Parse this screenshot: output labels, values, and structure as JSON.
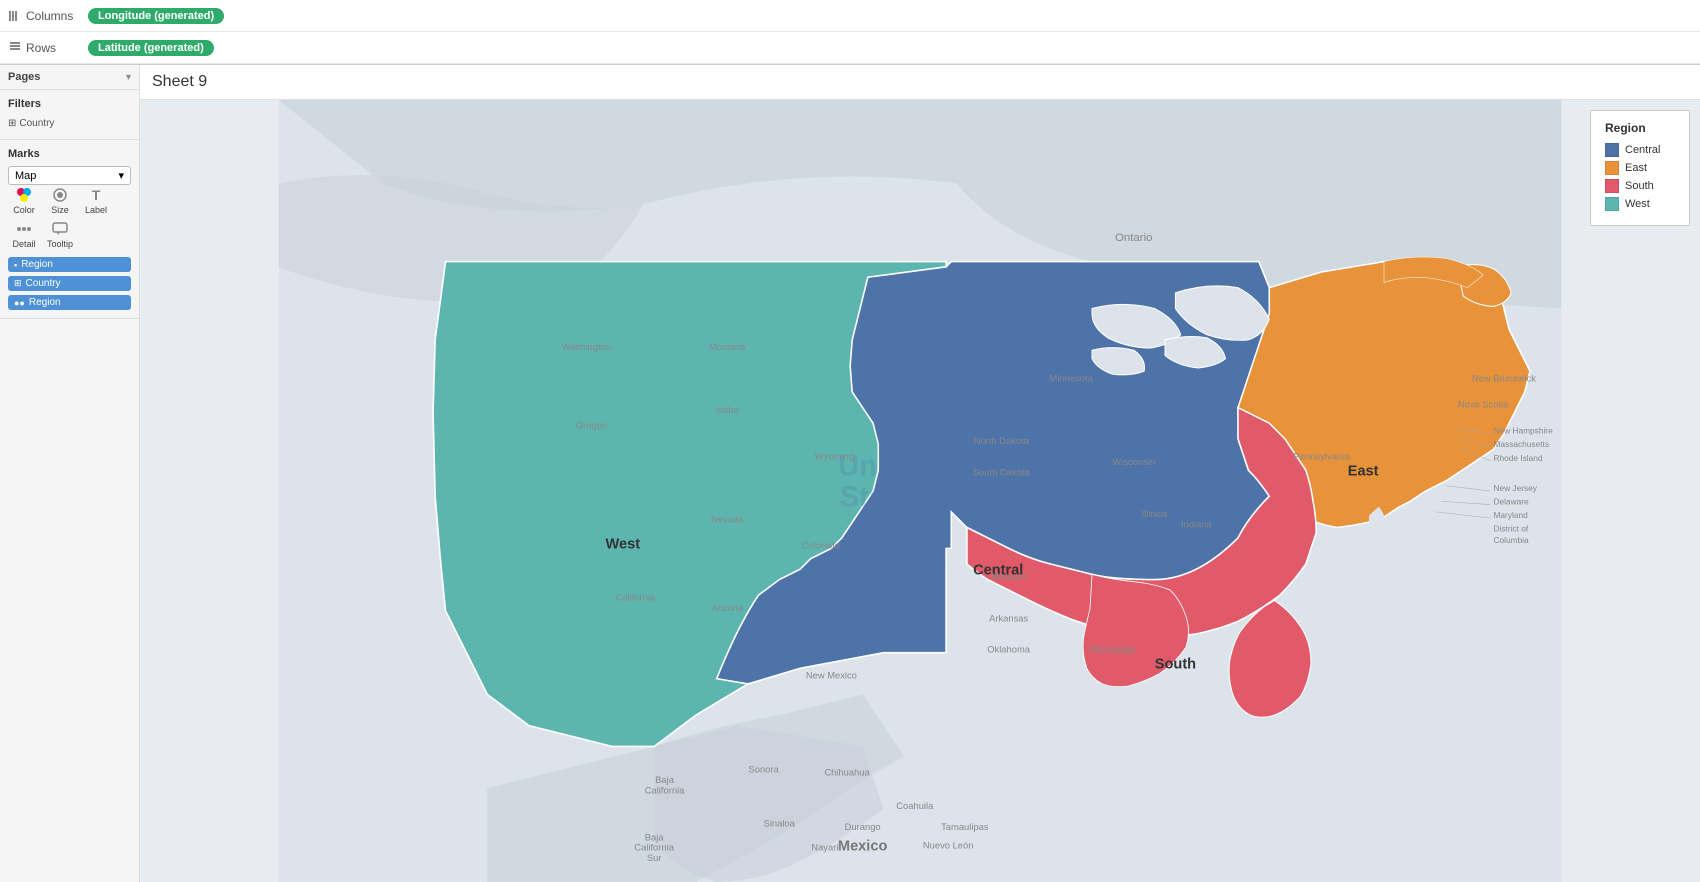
{
  "header": {
    "columns_label": "Columns",
    "columns_pill": "Longitude (generated)",
    "rows_label": "Rows",
    "rows_pill": "Latitude (generated)"
  },
  "left_panel": {
    "pages_label": "Pages",
    "filters_label": "Filters",
    "marks_label": "Marks",
    "marks_type": "Map",
    "marks_icons": [
      {
        "name": "color",
        "label": "Color",
        "icon": "⬛"
      },
      {
        "name": "size",
        "label": "Size",
        "icon": "◉"
      },
      {
        "name": "label",
        "label": "Label",
        "icon": "T"
      },
      {
        "name": "detail",
        "label": "Detail",
        "icon": "⋯"
      },
      {
        "name": "tooltip",
        "label": "Tooltip",
        "icon": "💬"
      }
    ],
    "mark_pills": [
      {
        "icon": "▪",
        "label": "Region"
      },
      {
        "icon": "⊞",
        "label": "Country"
      },
      {
        "icon": "●●●",
        "label": "Region"
      }
    ]
  },
  "sheet": {
    "title": "Sheet 9"
  },
  "legend": {
    "title": "Region",
    "items": [
      {
        "label": "Central",
        "color": "#4e73a8"
      },
      {
        "label": "East",
        "color": "#e8923a"
      },
      {
        "label": "South",
        "color": "#e05a6a"
      },
      {
        "label": "West",
        "color": "#5db5b0"
      }
    ]
  },
  "map": {
    "region_labels": [
      {
        "id": "west",
        "label": "West",
        "x": "36%",
        "y": "56%"
      },
      {
        "id": "central",
        "label": "Central",
        "x": "54%",
        "y": "60%"
      },
      {
        "id": "east",
        "label": "East",
        "x": "73%",
        "y": "46%"
      },
      {
        "id": "south",
        "label": "South",
        "x": "65%",
        "y": "70%"
      }
    ],
    "geo_labels": [
      "Ontario",
      "Mexico",
      "Baja California",
      "Sonora",
      "Chihuahua",
      "Coahuila",
      "Durango",
      "Tamaulipas",
      "Sinaloa",
      "Baja California Sur",
      "Nayarit",
      "Nuevo León",
      "Nova Scotia",
      "New Brunswick",
      "New Hampshire",
      "Massachusetts",
      "Rhode Island",
      "New Jersey",
      "Delaware",
      "Maryland",
      "District of Columbia"
    ]
  }
}
